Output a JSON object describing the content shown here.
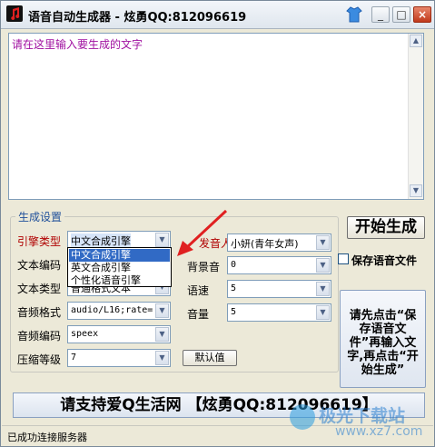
{
  "window": {
    "title": "语音自动生成器 - 炫勇QQ:812096619",
    "minimize": "_",
    "maximize": "□",
    "close": "×"
  },
  "input": {
    "placeholder": "请在这里输入要生成的文字"
  },
  "settings": {
    "group_title": "生成设置",
    "engine_type": {
      "label": "引擎类型",
      "value": "中文合成引擎"
    },
    "engine_options": [
      "中文合成引擎",
      "英文合成引擎",
      "个性化语音引擎"
    ],
    "text_encoding": {
      "label": "文本编码"
    },
    "text_type": {
      "label": "文本类型",
      "value": "普通格式文本"
    },
    "audio_format": {
      "label": "音频格式",
      "value": "audio/L16;rate="
    },
    "audio_encoding": {
      "label": "音频编码",
      "value": "speex"
    },
    "compress_level": {
      "label": "压缩等级",
      "value": "7"
    },
    "speaker": {
      "label": "发音人",
      "value": "小妍(青年女声)"
    },
    "bg_music": {
      "label": "背景音",
      "value": "0"
    },
    "speed": {
      "label": "语速",
      "value": "5"
    },
    "volume": {
      "label": "音量",
      "value": "5"
    },
    "default_button": "默认值"
  },
  "actions": {
    "start_button": "开始生成",
    "save_checkbox_label": "保存语音文件",
    "save_checked": false,
    "save_button": "请先点击“保存语音文件”再输入文字,再点击“开始生成”"
  },
  "banner": "请支持爱Q生活网 【炫勇QQ:812096619】",
  "status": "已成功连接服务器",
  "watermark": {
    "name": "极光下载站",
    "url": "www.xz7.com"
  },
  "colors": {
    "accent": "#316ac5",
    "placeholder": "#a010a0",
    "label_red": "#b00000",
    "group_title": "#1f4f9a",
    "arrow": "#e02020"
  }
}
